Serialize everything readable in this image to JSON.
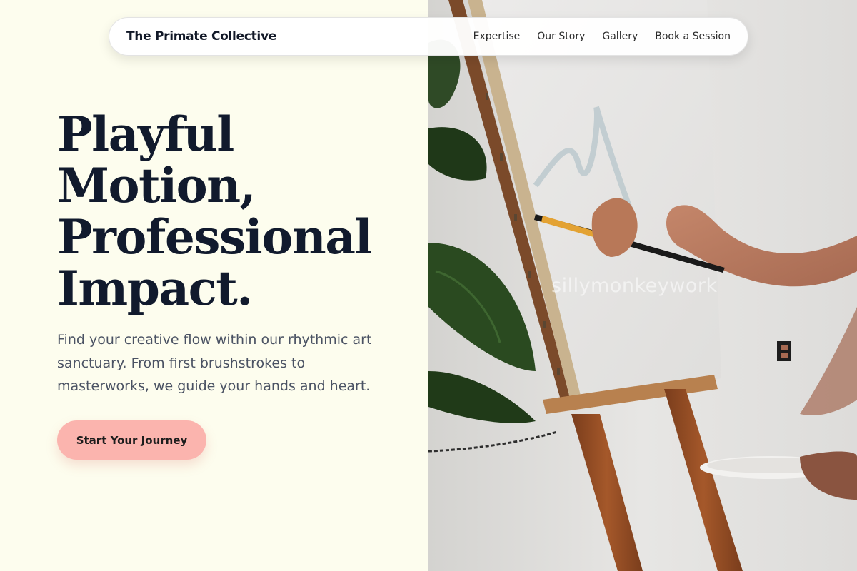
{
  "nav": {
    "brand": "The Primate Collective",
    "links": [
      "Expertise",
      "Our Story",
      "Gallery",
      "Book a Session"
    ]
  },
  "hero": {
    "title_lines": [
      "Playful",
      "Motion,",
      "Professional",
      "Impact."
    ],
    "subtitle": "Find your creative flow within our rhythmic art sanctuary. From first brushstrokes to masterworks, we guide your hands and heart.",
    "cta_label": "Start Your Journey"
  },
  "image": {
    "watermark": "sillymonkeywork"
  },
  "colors": {
    "background": "#fdfdee",
    "heading": "#111a2d",
    "body_text": "#4a5263",
    "cta": "#fbb4ae"
  }
}
